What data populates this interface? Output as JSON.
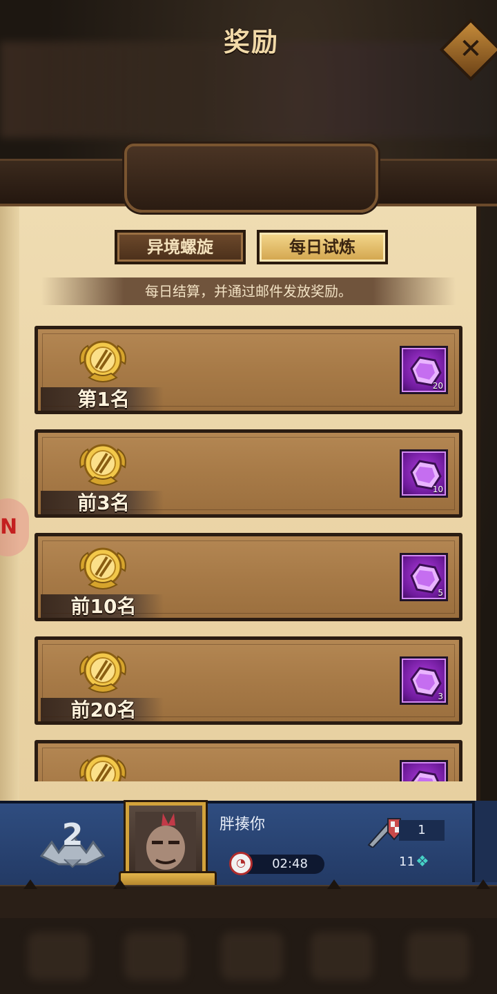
{
  "header": {
    "title": "奖励"
  },
  "tabs": [
    {
      "label": "异境螺旋",
      "active": false
    },
    {
      "label": "每日试炼",
      "active": true
    }
  ],
  "notice": "每日结算，并通过邮件发放奖励。",
  "rewards": [
    {
      "rank": "第1名",
      "item": "purple-gem-icon",
      "count": "20"
    },
    {
      "rank": "前3名",
      "item": "purple-gem-icon",
      "count": "10"
    },
    {
      "rank": "前10名",
      "item": "purple-gem-icon",
      "count": "5"
    },
    {
      "rank": "前20名",
      "item": "purple-gem-icon",
      "count": "3"
    },
    {
      "rank": "",
      "item": "purple-gem-icon",
      "count": ""
    }
  ],
  "player": {
    "rank": "2",
    "name": "胖揍你",
    "timer": "02:48",
    "power": "1",
    "coins": "11"
  },
  "colors": {
    "panel": "#ead3a4",
    "gem": "#b23de0",
    "footer": "#2f4d80",
    "tab_active": "#f4d88e"
  }
}
